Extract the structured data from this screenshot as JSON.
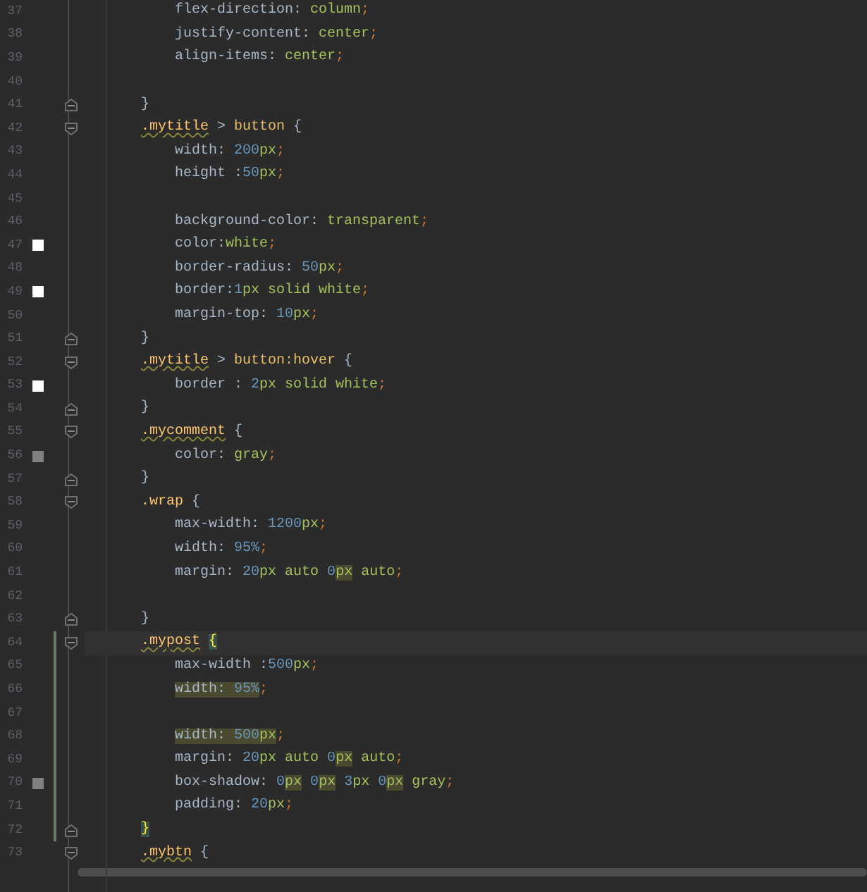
{
  "lines": [
    {
      "number": "37",
      "kind": "declaration",
      "current": false,
      "modified": false,
      "tokens": [
        {
          "text": "flex-direction: ",
          "kind": "p",
          "highlighted": false
        },
        {
          "text": "column",
          "kind": "v",
          "highlighted": false
        },
        {
          "text": ";",
          "kind": "s",
          "highlighted": false
        }
      ]
    },
    {
      "number": "38",
      "kind": "declaration",
      "current": false,
      "modified": false,
      "tokens": [
        {
          "text": "justify-content: ",
          "kind": "p",
          "highlighted": false
        },
        {
          "text": "center",
          "kind": "v",
          "highlighted": false
        },
        {
          "text": ";",
          "kind": "s",
          "highlighted": false
        }
      ]
    },
    {
      "number": "39",
      "kind": "declaration",
      "current": false,
      "modified": false,
      "tokens": [
        {
          "text": "align-items: ",
          "kind": "p",
          "highlighted": false
        },
        {
          "text": "center",
          "kind": "v",
          "highlighted": false
        },
        {
          "text": ";",
          "kind": "s",
          "highlighted": false
        }
      ]
    },
    {
      "number": "40",
      "kind": "blank",
      "current": false,
      "modified": false
    },
    {
      "number": "41",
      "kind": "rule",
      "fold": {
        "kind": "end"
      },
      "current": false,
      "modified": false,
      "tokens": [
        {
          "text": "}",
          "kind": "b",
          "highlighted": false
        }
      ]
    },
    {
      "number": "42",
      "kind": "rule",
      "fold": {
        "kind": "start"
      },
      "current": false,
      "modified": false,
      "tokens": [
        {
          "text": ".mytitle",
          "kind": "cw",
          "highlighted": false
        },
        {
          "text": " > ",
          "kind": "b",
          "highlighted": false
        },
        {
          "text": "button",
          "kind": "t",
          "highlighted": false
        },
        {
          "text": " {",
          "kind": "b",
          "highlighted": false
        }
      ]
    },
    {
      "number": "43",
      "kind": "declaration",
      "current": false,
      "modified": false,
      "tokens": [
        {
          "text": "width: ",
          "kind": "p",
          "highlighted": false
        },
        {
          "text": "200",
          "kind": "n",
          "highlighted": false
        },
        {
          "text": "px",
          "kind": "v",
          "highlighted": false
        },
        {
          "text": ";",
          "kind": "s",
          "highlighted": false
        }
      ]
    },
    {
      "number": "44",
      "kind": "declaration",
      "current": false,
      "modified": false,
      "tokens": [
        {
          "text": "height :",
          "kind": "p",
          "highlighted": false
        },
        {
          "text": "50",
          "kind": "n",
          "highlighted": false
        },
        {
          "text": "px",
          "kind": "v",
          "highlighted": false
        },
        {
          "text": ";",
          "kind": "s",
          "highlighted": false
        }
      ]
    },
    {
      "number": "45",
      "kind": "blank",
      "current": false,
      "modified": false
    },
    {
      "number": "46",
      "kind": "declaration",
      "current": false,
      "modified": false,
      "tokens": [
        {
          "text": "background-color: ",
          "kind": "p",
          "highlighted": false
        },
        {
          "text": "transparent",
          "kind": "v",
          "highlighted": false
        },
        {
          "text": ";",
          "kind": "s",
          "highlighted": false
        }
      ]
    },
    {
      "number": "47",
      "kind": "declaration",
      "current": false,
      "modified": false,
      "color": "#ffffff",
      "tokens": [
        {
          "text": "color:",
          "kind": "p",
          "highlighted": false
        },
        {
          "text": "white",
          "kind": "v",
          "highlighted": false
        },
        {
          "text": ";",
          "kind": "s",
          "highlighted": false
        }
      ]
    },
    {
      "number": "48",
      "kind": "declaration",
      "current": false,
      "modified": false,
      "tokens": [
        {
          "text": "border-radius: ",
          "kind": "p",
          "highlighted": false
        },
        {
          "text": "50",
          "kind": "n",
          "highlighted": false
        },
        {
          "text": "px",
          "kind": "v",
          "highlighted": false
        },
        {
          "text": ";",
          "kind": "s",
          "highlighted": false
        }
      ]
    },
    {
      "number": "49",
      "kind": "declaration",
      "current": false,
      "modified": false,
      "color": "#ffffff",
      "tokens": [
        {
          "text": "border:",
          "kind": "p",
          "highlighted": false
        },
        {
          "text": "1",
          "kind": "n",
          "highlighted": false
        },
        {
          "text": "px solid white",
          "kind": "v",
          "highlighted": false
        },
        {
          "text": ";",
          "kind": "s",
          "highlighted": false
        }
      ]
    },
    {
      "number": "50",
      "kind": "declaration",
      "current": false,
      "modified": false,
      "tokens": [
        {
          "text": "margin-top: ",
          "kind": "p",
          "highlighted": false
        },
        {
          "text": "10",
          "kind": "n",
          "highlighted": false
        },
        {
          "text": "px",
          "kind": "v",
          "highlighted": false
        },
        {
          "text": ";",
          "kind": "s",
          "highlighted": false
        }
      ]
    },
    {
      "number": "51",
      "kind": "rule",
      "fold": {
        "kind": "end"
      },
      "current": false,
      "modified": false,
      "tokens": [
        {
          "text": "}",
          "kind": "b",
          "highlighted": false
        }
      ]
    },
    {
      "number": "52",
      "kind": "rule",
      "fold": {
        "kind": "start"
      },
      "current": false,
      "modified": false,
      "tokens": [
        {
          "text": ".mytitle",
          "kind": "cw",
          "highlighted": false
        },
        {
          "text": " > ",
          "kind": "b",
          "highlighted": false
        },
        {
          "text": "button:hover",
          "kind": "t",
          "highlighted": false
        },
        {
          "text": " {",
          "kind": "b",
          "highlighted": false
        }
      ]
    },
    {
      "number": "53",
      "kind": "declaration",
      "current": false,
      "modified": false,
      "color": "#ffffff",
      "tokens": [
        {
          "text": "border : ",
          "kind": "p",
          "highlighted": false
        },
        {
          "text": "2",
          "kind": "n",
          "highlighted": false
        },
        {
          "text": "px solid white",
          "kind": "v",
          "highlighted": false
        },
        {
          "text": ";",
          "kind": "s",
          "highlighted": false
        }
      ]
    },
    {
      "number": "54",
      "kind": "rule",
      "fold": {
        "kind": "end"
      },
      "current": false,
      "modified": false,
      "tokens": [
        {
          "text": "}",
          "kind": "b",
          "highlighted": false
        }
      ]
    },
    {
      "number": "55",
      "kind": "rule",
      "fold": {
        "kind": "start"
      },
      "current": false,
      "modified": false,
      "tokens": [
        {
          "text": ".mycomment",
          "kind": "cw",
          "highlighted": false
        },
        {
          "text": " {",
          "kind": "b",
          "highlighted": false
        }
      ]
    },
    {
      "number": "56",
      "kind": "declaration",
      "current": false,
      "modified": false,
      "color": "#808080",
      "tokens": [
        {
          "text": "color: ",
          "kind": "p",
          "highlighted": false
        },
        {
          "text": "gray",
          "kind": "v",
          "highlighted": false
        },
        {
          "text": ";",
          "kind": "s",
          "highlighted": false
        }
      ]
    },
    {
      "number": "57",
      "kind": "rule",
      "fold": {
        "kind": "end"
      },
      "current": false,
      "modified": false,
      "tokens": [
        {
          "text": "}",
          "kind": "b",
          "highlighted": false
        }
      ]
    },
    {
      "number": "58",
      "kind": "rule",
      "fold": {
        "kind": "start"
      },
      "current": false,
      "modified": false,
      "tokens": [
        {
          "text": ".wrap",
          "kind": "c",
          "highlighted": false
        },
        {
          "text": " {",
          "kind": "b",
          "highlighted": false
        }
      ]
    },
    {
      "number": "59",
      "kind": "declaration",
      "current": false,
      "modified": false,
      "tokens": [
        {
          "text": "max-width: ",
          "kind": "p",
          "highlighted": false
        },
        {
          "text": "1200",
          "kind": "n",
          "highlighted": false
        },
        {
          "text": "px",
          "kind": "v",
          "highlighted": false
        },
        {
          "text": ";",
          "kind": "s",
          "highlighted": false
        }
      ]
    },
    {
      "number": "60",
      "kind": "declaration",
      "current": false,
      "modified": false,
      "tokens": [
        {
          "text": "width: ",
          "kind": "p",
          "highlighted": false
        },
        {
          "text": "95%",
          "kind": "n",
          "highlighted": false
        },
        {
          "text": ";",
          "kind": "s",
          "highlighted": false
        }
      ]
    },
    {
      "number": "61",
      "kind": "declaration",
      "current": false,
      "modified": false,
      "tokens": [
        {
          "text": "margin: ",
          "kind": "p",
          "highlighted": false
        },
        {
          "text": "20",
          "kind": "n",
          "highlighted": false
        },
        {
          "text": "px auto ",
          "kind": "v",
          "highlighted": false
        },
        {
          "text": "0",
          "kind": "n",
          "highlighted": false
        },
        {
          "text": "px",
          "kind": "v",
          "highlighted": true
        },
        {
          "text": " auto",
          "kind": "v",
          "highlighted": false
        },
        {
          "text": ";",
          "kind": "s",
          "highlighted": false
        }
      ]
    },
    {
      "number": "62",
      "kind": "blank",
      "current": false,
      "modified": false
    },
    {
      "number": "63",
      "kind": "rule",
      "fold": {
        "kind": "end"
      },
      "current": false,
      "modified": false,
      "tokens": [
        {
          "text": "}",
          "kind": "b",
          "highlighted": false
        }
      ]
    },
    {
      "number": "64",
      "kind": "rule",
      "fold": {
        "kind": "start"
      },
      "current": true,
      "modified": true,
      "tokens": [
        {
          "text": ".mypost",
          "kind": "cw",
          "highlighted": false
        },
        {
          "text": "{",
          "kind": "ms",
          "highlighted": false
        }
      ]
    },
    {
      "number": "65",
      "kind": "declaration",
      "current": false,
      "modified": true,
      "tokens": [
        {
          "text": "max-width :",
          "kind": "p",
          "highlighted": false
        },
        {
          "text": "500",
          "kind": "n",
          "highlighted": false
        },
        {
          "text": "px",
          "kind": "v",
          "highlighted": false
        },
        {
          "text": ";",
          "kind": "s",
          "highlighted": false
        }
      ]
    },
    {
      "number": "66",
      "kind": "declaration",
      "current": false,
      "modified": true,
      "tokens": [
        {
          "text": "width: ",
          "kind": "p",
          "highlighted": true
        },
        {
          "text": "95%",
          "kind": "n",
          "highlighted": true
        },
        {
          "text": ";",
          "kind": "s",
          "highlighted": false
        }
      ]
    },
    {
      "number": "67",
      "kind": "blank",
      "current": false,
      "modified": true
    },
    {
      "number": "68",
      "kind": "declaration",
      "current": false,
      "modified": true,
      "tokens": [
        {
          "text": "width: ",
          "kind": "p",
          "highlighted": true
        },
        {
          "text": "500",
          "kind": "n",
          "highlighted": true
        },
        {
          "text": "px",
          "kind": "v",
          "highlighted": true
        },
        {
          "text": ";",
          "kind": "s",
          "highlighted": false
        }
      ]
    },
    {
      "number": "69",
      "kind": "declaration",
      "current": false,
      "modified": true,
      "tokens": [
        {
          "text": "margin: ",
          "kind": "p",
          "highlighted": false
        },
        {
          "text": "20",
          "kind": "n",
          "highlighted": false
        },
        {
          "text": "px auto ",
          "kind": "v",
          "highlighted": false
        },
        {
          "text": "0",
          "kind": "n",
          "highlighted": false
        },
        {
          "text": "px",
          "kind": "v",
          "highlighted": true
        },
        {
          "text": " auto",
          "kind": "v",
          "highlighted": false
        },
        {
          "text": ";",
          "kind": "s",
          "highlighted": false
        }
      ]
    },
    {
      "number": "70",
      "kind": "declaration",
      "current": false,
      "modified": true,
      "color": "#808080",
      "tokens": [
        {
          "text": "box-shadow: ",
          "kind": "p",
          "highlighted": false
        },
        {
          "text": "0",
          "kind": "n",
          "highlighted": false
        },
        {
          "text": "px",
          "kind": "v",
          "highlighted": true
        },
        {
          "text": " 0",
          "kind": "n",
          "highlighted": false
        },
        {
          "text": "px",
          "kind": "v",
          "highlighted": true
        },
        {
          "text": " 3",
          "kind": "n",
          "highlighted": false
        },
        {
          "text": "px ",
          "kind": "v",
          "highlighted": false
        },
        {
          "text": "0",
          "kind": "n",
          "highlighted": false
        },
        {
          "text": "px",
          "kind": "v",
          "highlighted": true
        },
        {
          "text": " gray",
          "kind": "v",
          "highlighted": false
        },
        {
          "text": ";",
          "kind": "s",
          "highlighted": false
        }
      ]
    },
    {
      "number": "71",
      "kind": "declaration",
      "current": false,
      "modified": true,
      "tokens": [
        {
          "text": "padding: ",
          "kind": "p",
          "highlighted": false
        },
        {
          "text": "20",
          "kind": "n",
          "highlighted": false
        },
        {
          "text": "px",
          "kind": "v",
          "highlighted": false
        },
        {
          "text": ";",
          "kind": "s",
          "highlighted": false
        }
      ]
    },
    {
      "number": "72",
      "kind": "rule",
      "fold": {
        "kind": "end"
      },
      "current": false,
      "modified": true,
      "tokens": [
        {
          "text": "}",
          "kind": "m",
          "highlighted": false
        }
      ]
    },
    {
      "number": "73",
      "kind": "rule",
      "fold": {
        "kind": "start"
      },
      "current": false,
      "modified": false,
      "tokens": [
        {
          "text": ".mybtn",
          "kind": "cw",
          "highlighted": false
        },
        {
          "text": " {",
          "kind": "b",
          "highlighted": false
        }
      ]
    }
  ]
}
